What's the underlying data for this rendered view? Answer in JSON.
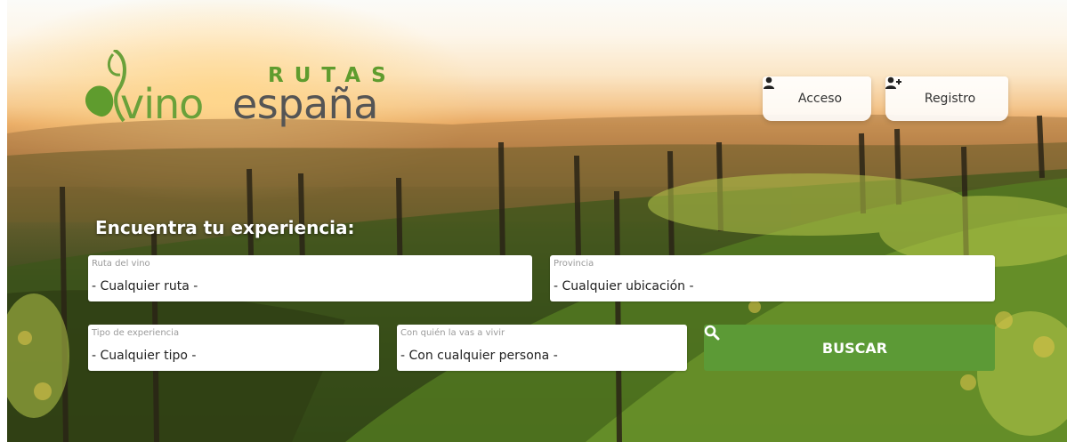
{
  "logo": {
    "top": "RUTAS",
    "left": "vino",
    "right": "españa"
  },
  "nav": {
    "login_label": "Acceso",
    "register_label": "Registro"
  },
  "search": {
    "heading": "Encuentra tu experiencia:",
    "fields": [
      {
        "label": "Ruta del vino",
        "value": "- Cualquier ruta -"
      },
      {
        "label": "Provincia",
        "value": "- Cualquier ubicación -"
      },
      {
        "label": "Tipo de experiencia",
        "value": "- Cualquier tipo -"
      },
      {
        "label": "Con quién la vas a vivir",
        "value": "- Con cualquier persona -"
      }
    ],
    "button_label": "BUSCAR"
  },
  "icons": {
    "login": "user-icon",
    "register": "user-plus-icon",
    "search": "search-icon"
  },
  "colors": {
    "brand_green": "#5c9a36",
    "logo_green": "#6aa13a",
    "logo_gray": "#555555"
  }
}
